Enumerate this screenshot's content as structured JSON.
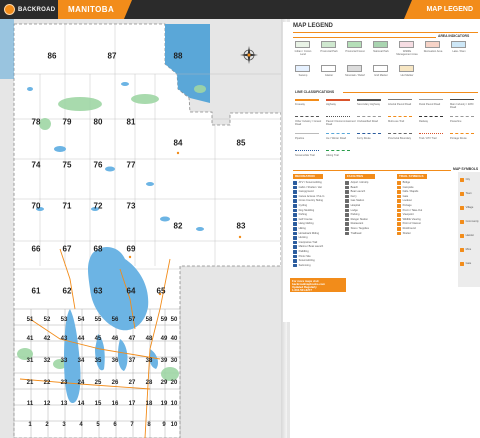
{
  "header": {
    "brand": "BACKROAD",
    "left_title": "MANITOBA",
    "right_title": "MAP LEGEND"
  },
  "legend": {
    "title": "MAP LEGEND",
    "area_indicators_heading": "AREA INDICATORS",
    "line_classifications_heading": "LINE CLASSIFICATIONS",
    "map_symbols_heading": "MAP SYMBOLS",
    "area_items": [
      "Indian / Crown Land",
      "Provincial Park",
      "Provincial Forest",
      "National Park",
      "Wildlife Management Area",
      "Recreation Area",
      "Lake / Dam",
      "Swamp",
      "Glacier",
      "Mountain / Relief",
      "Grid Marker",
      "Hut Marker"
    ],
    "line_items": [
      "Freeway",
      "Highway",
      "Secondary Highway",
      "Arterial Paved Road",
      "Rural Paved Road",
      "Main Industry / 2WD Road",
      "Other Industry / Gravel Road",
      "Paved / Decommissioned Road",
      "Unclassified Road",
      "Multi-use Trail",
      "Railway",
      "Powerline",
      "Pipeline",
      "Ice / Winter Road",
      "Ferry Route",
      "Provincial Boundary",
      "Trail / ATV Trail",
      "Portage Route",
      "Snowmobile Trail",
      "Hiking Trail"
    ],
    "columns": [
      {
        "heading": "RECREATION",
        "color": "#f28c1a",
        "items": [
          "ATV / Snowmobiling",
          "Cabin / Shelter / Hut",
          "Campground",
          "Canoe Access / Put-In",
          "Cross Country Skiing",
          "Cycling",
          "Dog Sledding",
          "Fishing",
          "Golf Course",
          "Hang Gliding",
          "Hiking",
          "Horseback Riding",
          "Hunting",
          "Interpretive Trail",
          "Marina / Boat Launch",
          "Paddling",
          "Picnic Site",
          "Snowmobiling",
          "Swimming"
        ]
      },
      {
        "heading": "FACILITIES",
        "color": "#f28c1a",
        "items": [
          "Airport / Airstrip",
          "Beach",
          "Boat Launch",
          "Ferry",
          "Gas Station",
          "Hospital",
          "Lodge",
          "Parking",
          "Ranger Station",
          "Restaurant",
          "Store / Supplies",
          "Trailhead"
        ]
      },
      {
        "heading": "TRAIL SYMBOLS",
        "color": "#f28c1a",
        "items": [
          "Bridge",
          "Campsite",
          "Falls / Rapids",
          "Gate",
          "Lookout",
          "Portage",
          "Put-In / Take-Out",
          "Viewpoint",
          "Wildlife Viewing",
          "Point of Interest",
          "Rockhound",
          "Shelter"
        ]
      }
    ],
    "symbols_panel": [
      "City",
      "Town",
      "Village",
      "Community",
      "Hamlet",
      "Mine",
      "Gate"
    ],
    "url_box": [
      "For more maps visit",
      "backroadmapbooks.com",
      "Updated Regularly",
      "1-604-521-6277"
    ]
  },
  "map": {
    "grid_numbers": [
      "86",
      "87",
      "88",
      "78",
      "79",
      "80",
      "81",
      "84",
      "85",
      "74",
      "75",
      "76",
      "77",
      "70",
      "71",
      "72",
      "73",
      "82",
      "83",
      "66",
      "67",
      "68",
      "69",
      "61",
      "62",
      "63",
      "64",
      "65",
      "51",
      "52",
      "53",
      "54",
      "55",
      "56",
      "57",
      "58",
      "59",
      "50",
      "41",
      "42",
      "43",
      "44",
      "45",
      "46",
      "47",
      "48",
      "49",
      "40",
      "31",
      "32",
      "33",
      "34",
      "35",
      "36",
      "37",
      "38",
      "39",
      "30",
      "21",
      "22",
      "23",
      "24",
      "25",
      "26",
      "27",
      "28",
      "29",
      "20",
      "11",
      "12",
      "13",
      "14",
      "15",
      "16",
      "17",
      "18",
      "19",
      "10",
      "1",
      "2",
      "3",
      "4",
      "5",
      "6",
      "7",
      "8",
      "9",
      "10"
    ]
  }
}
